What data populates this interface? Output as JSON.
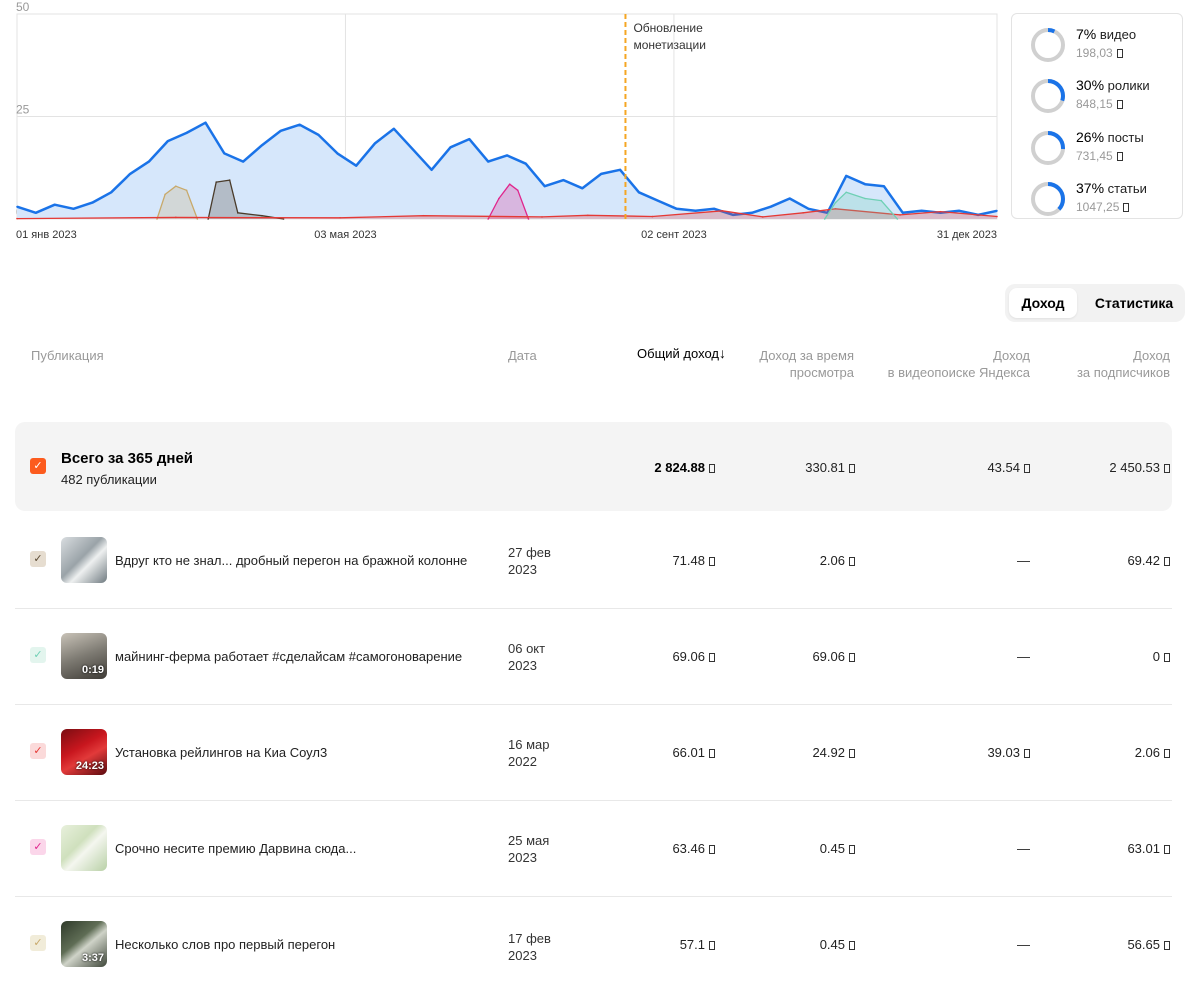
{
  "chart_data": {
    "type": "area",
    "x_range": [
      "2023-01-01",
      "2023-12-31"
    ],
    "x_ticks": [
      "01 янв 2023",
      "03 мая 2023",
      "02 сент 2023",
      "31 дек 2023"
    ],
    "y_ticks": [
      "0",
      "25",
      "50"
    ],
    "ylim": [
      0,
      50
    ],
    "grid": true,
    "annotation": {
      "date": "2023-08-15",
      "label": "Обновление монетизации",
      "color": "#f5a623"
    },
    "series": [
      {
        "color": "#1a73e8",
        "fill": "#d6e7fb",
        "values": [
          [
            "2023-01-01",
            3.0
          ],
          [
            "2023-01-08",
            1.5
          ],
          [
            "2023-01-15",
            3.5
          ],
          [
            "2023-01-22",
            2.5
          ],
          [
            "2023-01-29",
            4.0
          ],
          [
            "2023-02-05",
            6.5
          ],
          [
            "2023-02-12",
            11.0
          ],
          [
            "2023-02-19",
            14.0
          ],
          [
            "2023-02-26",
            19.0
          ],
          [
            "2023-03-05",
            21.0
          ],
          [
            "2023-03-12",
            23.5
          ],
          [
            "2023-03-19",
            16.0
          ],
          [
            "2023-03-26",
            14.0
          ],
          [
            "2023-04-02",
            18.0
          ],
          [
            "2023-04-09",
            21.5
          ],
          [
            "2023-04-16",
            23.0
          ],
          [
            "2023-04-23",
            20.5
          ],
          [
            "2023-04-30",
            16.0
          ],
          [
            "2023-05-07",
            13.0
          ],
          [
            "2023-05-14",
            18.5
          ],
          [
            "2023-05-21",
            22.0
          ],
          [
            "2023-05-28",
            17.0
          ],
          [
            "2023-06-04",
            12.0
          ],
          [
            "2023-06-11",
            17.5
          ],
          [
            "2023-06-18",
            19.5
          ],
          [
            "2023-06-25",
            14.0
          ],
          [
            "2023-07-02",
            15.5
          ],
          [
            "2023-07-09",
            13.5
          ],
          [
            "2023-07-16",
            8.0
          ],
          [
            "2023-07-23",
            9.5
          ],
          [
            "2023-07-30",
            7.5
          ],
          [
            "2023-08-06",
            11.0
          ],
          [
            "2023-08-13",
            12.0
          ],
          [
            "2023-08-20",
            6.5
          ],
          [
            "2023-08-27",
            4.5
          ],
          [
            "2023-09-03",
            2.5
          ],
          [
            "2023-09-10",
            2.0
          ],
          [
            "2023-09-17",
            2.5
          ],
          [
            "2023-09-24",
            1.0
          ],
          [
            "2023-10-01",
            1.5
          ],
          [
            "2023-10-08",
            3.0
          ],
          [
            "2023-10-15",
            5.0
          ],
          [
            "2023-10-22",
            2.5
          ],
          [
            "2023-10-29",
            1.5
          ],
          [
            "2023-11-05",
            10.5
          ],
          [
            "2023-11-12",
            8.5
          ],
          [
            "2023-11-19",
            8.0
          ],
          [
            "2023-11-26",
            1.5
          ],
          [
            "2023-12-03",
            2.0
          ],
          [
            "2023-12-10",
            1.5
          ],
          [
            "2023-12-17",
            2.0
          ],
          [
            "2023-12-24",
            1.0
          ],
          [
            "2023-12-31",
            2.0
          ]
        ]
      },
      {
        "color": "#c8a96a",
        "values": [
          [
            "2023-02-22",
            0
          ],
          [
            "2023-02-25",
            6.0
          ],
          [
            "2023-03-01",
            8.0
          ],
          [
            "2023-03-05",
            7.0
          ],
          [
            "2023-03-09",
            0
          ]
        ]
      },
      {
        "color": "#4a3b2a",
        "values": [
          [
            "2023-03-13",
            0
          ],
          [
            "2023-03-16",
            9.0
          ],
          [
            "2023-03-21",
            9.5
          ],
          [
            "2023-03-24",
            1.5
          ],
          [
            "2023-04-02",
            0.8
          ],
          [
            "2023-04-10",
            0
          ]
        ]
      },
      {
        "color": "#e0258c",
        "values": [
          [
            "2023-06-25",
            0
          ],
          [
            "2023-06-29",
            5.0
          ],
          [
            "2023-07-03",
            8.5
          ],
          [
            "2023-07-06",
            7.0
          ],
          [
            "2023-07-10",
            0
          ]
        ]
      },
      {
        "color": "#e53935",
        "values": [
          [
            "2023-01-01",
            0.1
          ],
          [
            "2023-03-01",
            0.4
          ],
          [
            "2023-05-01",
            0.3
          ],
          [
            "2023-06-01",
            0.8
          ],
          [
            "2023-07-15",
            0.5
          ],
          [
            "2023-08-01",
            0.9
          ],
          [
            "2023-08-25",
            0.6
          ],
          [
            "2023-09-20",
            2.0
          ],
          [
            "2023-10-05",
            0.5
          ],
          [
            "2023-10-20",
            1.5
          ],
          [
            "2023-11-01",
            2.5
          ],
          [
            "2023-11-25",
            1.0
          ],
          [
            "2023-12-10",
            1.8
          ],
          [
            "2023-12-31",
            0.6
          ]
        ]
      },
      {
        "color": "#6fd0b5",
        "values": [
          [
            "2023-10-28",
            0
          ],
          [
            "2023-11-01",
            4.0
          ],
          [
            "2023-11-05",
            6.5
          ],
          [
            "2023-11-12",
            5.0
          ],
          [
            "2023-11-18",
            4.5
          ],
          [
            "2023-11-24",
            0
          ]
        ]
      }
    ]
  },
  "breakdown": [
    {
      "percent": "7%",
      "percent_value": 7,
      "label": "видео",
      "amount": "198,03"
    },
    {
      "percent": "30%",
      "percent_value": 30,
      "label": "ролики",
      "amount": "848,15"
    },
    {
      "percent": "26%",
      "percent_value": 26,
      "label": "посты",
      "amount": "731,45"
    },
    {
      "percent": "37%",
      "percent_value": 37,
      "label": "статьи",
      "amount": "1047,25"
    }
  ],
  "tabs": {
    "income": "Доход",
    "stats": "Статистика",
    "active": "income"
  },
  "table": {
    "headers": {
      "publication": "Публикация",
      "date": "Дата",
      "total": "Общий доход",
      "view_time_1": "Доход за время",
      "view_time_2": "просмотра",
      "video_search_1": "Доход",
      "video_search_2": "в видеопоиске Яндекса",
      "subscribers_1": "Доход",
      "subscribers_2": "за подписчиков"
    },
    "total": {
      "title": "Всего за 365 дней",
      "subtitle": "482 публикации",
      "total": "2 824.88",
      "view_time": "330.81",
      "video_search": "43.54",
      "subscribers": "2 450.53"
    },
    "rows": [
      {
        "title": "Вдруг кто не знал... дробный перегон на бражной колонне",
        "date_1": "27 фев",
        "date_2": "2023",
        "duration": "",
        "total": "71.48",
        "view_time": "2.06",
        "video_search": "—",
        "subscribers": "69.42",
        "cb_color": "#e6ddd0",
        "cb_check": "#5b4a33"
      },
      {
        "title": "майнинг-ферма работает #сделайсам #самогоноварение",
        "date_1": "06 окт",
        "date_2": "2023",
        "duration": "0:19",
        "total": "69.06",
        "view_time": "69.06",
        "video_search": "—",
        "subscribers": "0",
        "cb_color": "#e3f5ee",
        "cb_check": "#6fd0b5"
      },
      {
        "title": "Установка рейлингов на Киа Соул3",
        "date_1": "16 мар",
        "date_2": "2022",
        "duration": "24:23",
        "total": "66.01",
        "view_time": "24.92",
        "video_search": "39.03",
        "subscribers": "2.06",
        "cb_color": "#fbdada",
        "cb_check": "#e53935"
      },
      {
        "title": "Срочно несите премию Дарвина сюда...",
        "date_1": "25 мая",
        "date_2": "2023",
        "duration": "",
        "total": "63.46",
        "view_time": "0.45",
        "video_search": "—",
        "subscribers": "63.01",
        "cb_color": "#fbd6ea",
        "cb_check": "#e0258c"
      },
      {
        "title": "Несколько слов про первый перегон",
        "date_1": "17 фев",
        "date_2": "2023",
        "duration": "3:37",
        "total": "57.1",
        "view_time": "0.45",
        "video_search": "—",
        "subscribers": "56.65",
        "cb_color": "#f1ecd9",
        "cb_check": "#c8a96a"
      }
    ]
  }
}
